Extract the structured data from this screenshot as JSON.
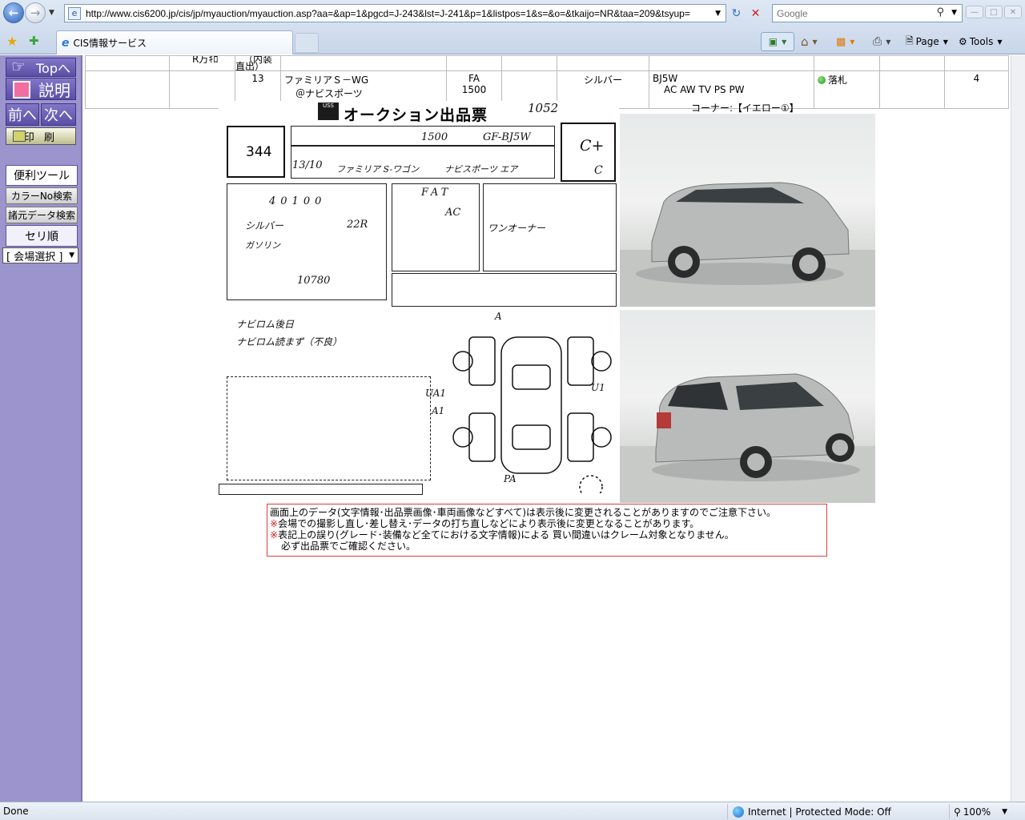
{
  "browser": {
    "url": "http://www.cis6200.jp/cis/jp/myauction/myauction.asp?aa=&ap=1&pgcd=J-243&lst=J-241&p=1&listpos=1&s=&o=&tkaijo=NR&taa=209&tsyup=",
    "search_placeholder": "Google",
    "tab_title": "CIS情報サービス",
    "page_menu": "Page",
    "tools_menu": "Tools",
    "status": "Done",
    "zone": "Internet | Protected Mode: Off",
    "zoom": "100%"
  },
  "sidebar": {
    "top": "Topへ",
    "explain": "説明",
    "prev": "前へ",
    "next": "次へ",
    "print": "印 刷",
    "tools_label": "便利ツール",
    "color_search": "カラーNo検索",
    "spec_search": "諸元データ検索",
    "order": "セリ順",
    "venue": "[ 会場選択 ]"
  },
  "listing": {
    "cut_texts": [
      "R万ｷﾛ",
      "（内装直出）"
    ],
    "lot": "13",
    "model": "ファミリアＳ－WG",
    "grade": "＠ナビスポーツ",
    "shift": "FA",
    "cc": "1500",
    "color": "シルバー",
    "chassis": "BJ5W",
    "equipment": "AC AW TV PS PW",
    "status": "落札",
    "score": "4"
  },
  "sheet": {
    "title": "オークション出品票",
    "corner": "コーナー:【イエロー①】",
    "lot_number": "344",
    "hand_number": "1052",
    "displacement": "1500",
    "model_code": "GF-BJ5W",
    "grade_score": "C+",
    "interior_score": "C",
    "first_reg": "13/10",
    "car_name": "ファミリア S-ワゴン",
    "grade": "ナビスポーツ エア",
    "mileage": "40100",
    "shift": "FAT",
    "aircon": "AC",
    "body_color": "シルバー",
    "color_code": "22R",
    "fuel": "ガソリン",
    "recycle_fee": "10780",
    "selling_point": "ワンオーナー",
    "note1": "ナビロム後日",
    "note2": "ナビロム読まず（不良）",
    "diag_a": "A",
    "diag_ua1": "UA1",
    "diag_a1": "A1",
    "diag_u1": "U1",
    "diag_pa": "PA"
  },
  "notice": {
    "line1": "画面上のデータ(文字情報･出品票画像･車両画像などすべて)は表示後に変更されることがありますのでご注意下さい。",
    "line2": "会場での撮影し直し･差し替え･データの打ち直しなどにより表示後に変更となることがあります。",
    "line3": "表記上の誤り(グレード･装備など全てにおける文字情報)による 買い間違いはクレーム対象となりません。",
    "line4": "必ず出品票でご確認ください。",
    "mark": "※"
  }
}
